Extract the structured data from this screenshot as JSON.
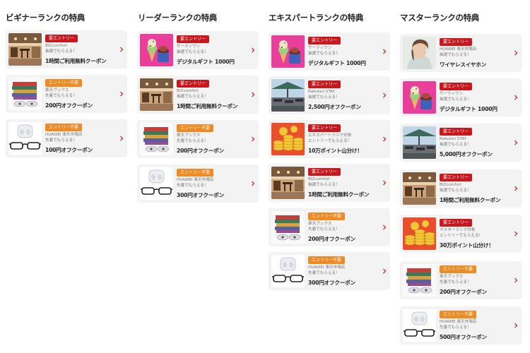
{
  "columns": [
    {
      "title": "ビギナーランクの特典",
      "cards": [
        {
          "badge": "要エントリー",
          "badge_type": "req",
          "line1": "BIZcomfort",
          "line2": "抽選でもらえる！",
          "title": "1時間ご利用無料クーポン",
          "image": "coworking-space"
        },
        {
          "badge": "エントリー不要",
          "badge_type": "no",
          "line1": "楽天ブックス",
          "line2": "先着でもらえる！",
          "title": "200円オフクーポン",
          "image": "books-earbuds"
        },
        {
          "badge": "エントリー不要",
          "badge_type": "no",
          "line1": "HUAWEI 楽天市場店",
          "line2": "先着でもらえる！",
          "title": "100円オフクーポン",
          "image": "earbuds-glasses"
        }
      ]
    },
    {
      "title": "リーダーランクの特典",
      "cards": [
        {
          "badge": "要エントリー",
          "badge_type": "req",
          "line1": "サーティワン",
          "line2": "抽選でもらえる！",
          "title": "デジタルギフト 1000円",
          "image": "ice-cream"
        },
        {
          "badge": "要エントリー",
          "badge_type": "req",
          "line1": "BIZcomfort",
          "line2": "抽選でもらえる！",
          "title": "1時間ご利用無料クーポン",
          "image": "coworking-space"
        },
        {
          "badge": "エントリー不要",
          "badge_type": "no",
          "line1": "楽天ブックス",
          "line2": "先着でもらえる！",
          "title": "200円オフクーポン",
          "image": "books-earbuds"
        },
        {
          "badge": "エントリー不要",
          "badge_type": "no",
          "line1": "HUAWEI 楽天市場店",
          "line2": "先着でもらえる！",
          "title": "300円オフクーポン",
          "image": "earbuds-glasses"
        }
      ]
    },
    {
      "title": "エキスパートランクの特典",
      "cards": [
        {
          "badge": "要エントリー",
          "badge_type": "req",
          "line1": "サーティワン",
          "line2": "抽選でもらえる！",
          "title": "デジタルギフト 1000円",
          "image": "ice-cream"
        },
        {
          "badge": "要エントリー",
          "badge_type": "req",
          "line1": "Rakuten STAY",
          "line2": "抽選でもらえる！",
          "title": "2,500円オフクーポン",
          "image": "terrace"
        },
        {
          "badge": "要エントリー",
          "badge_type": "req",
          "line1": "エキスパートランク対象",
          "line2": "エントリーでもらえる！",
          "title": "10万ポイント山分け！",
          "image": "coins"
        },
        {
          "badge": "要エントリー",
          "badge_type": "req",
          "line1": "BIZcomfort",
          "line2": "抽選でもらえる！",
          "title": "1時間ご利用無料クーポン",
          "image": "coworking-space"
        },
        {
          "badge": "エントリー不要",
          "badge_type": "no",
          "line1": "楽天ブックス",
          "line2": "先着でもらえる！",
          "title": "200円オフクーポン",
          "image": "books-earbuds"
        },
        {
          "badge": "エントリー不要",
          "badge_type": "no",
          "line1": "HUAWEI 楽天市場店",
          "line2": "先着でもらえる！",
          "title": "300円オフクーポン",
          "image": "earbuds-glasses"
        }
      ]
    },
    {
      "title": "マスターランクの特典",
      "cards": [
        {
          "badge": "要エントリー",
          "badge_type": "req",
          "line1": "HUAWEI 楽天市場店",
          "line2": "抽選でもらえる！",
          "title": "ワイヤレスイヤホン",
          "image": "woman-earbuds"
        },
        {
          "badge": "要エントリー",
          "badge_type": "req",
          "line1": "サーティワン",
          "line2": "抽選でもらえる！",
          "title": "デジタルギフト 1000円",
          "image": "ice-cream"
        },
        {
          "badge": "要エントリー",
          "badge_type": "req",
          "line1": "Rakuten STAY",
          "line2": "抽選でもらえる！",
          "title": "5,000円オフクーポン",
          "image": "terrace"
        },
        {
          "badge": "要エントリー",
          "badge_type": "req",
          "line1": "BIZcomfort",
          "line2": "抽選でもらえる！",
          "title": "1時間ご利用無料クーポン",
          "image": "coworking-space"
        },
        {
          "badge": "要エントリー",
          "badge_type": "req",
          "line1": "マスターランク対象",
          "line2": "エントリーでもらえる！",
          "title": "30万ポイント山分け！",
          "image": "coins"
        },
        {
          "badge": "エントリー不要",
          "badge_type": "no",
          "line1": "楽天ブックス",
          "line2": "先着でもらえる！",
          "title": "200円オフクーポン",
          "image": "books-earbuds"
        },
        {
          "badge": "エントリー不要",
          "badge_type": "no",
          "line1": "HUAWEI 楽天市場店",
          "line2": "先着でもらえる！",
          "title": "500円オフクーポン",
          "image": "earbuds-glasses"
        }
      ]
    }
  ],
  "icons": {
    "card_arrow": "chevron-right-icon"
  },
  "colors": {
    "entry_required": "#c9171e",
    "entry_not_required": "#f08a24",
    "card_background": "#f3f3f3",
    "chevron": "#c9171e"
  }
}
